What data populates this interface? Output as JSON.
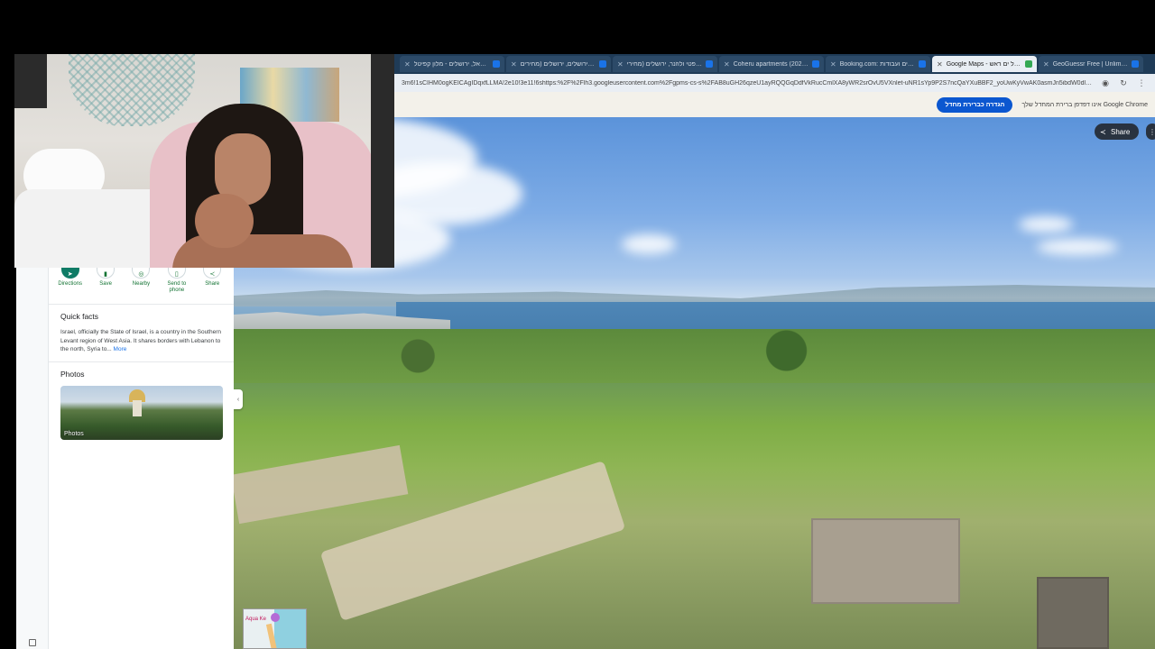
{
  "browser": {
    "tabs": [
      {
        "title": "ישראל, ירושלים - מלון קפיטל",
        "active": false
      },
      {
        "title": "מלון ירושלים, ירושלים (מחירים",
        "active": false
      },
      {
        "title": "מלון פטי ולוזנר, ירושלים (מחירי",
        "active": false
      },
      {
        "title": "Coheru apartments (2025 ב' ל",
        "active": false
      },
      {
        "title": "Booking.com: מלונים ועבודות",
        "active": false
      },
      {
        "title": "Google Maps - ישראל ים ראש",
        "active": true
      },
      {
        "title": "GeoGuessr Free | Unlimited Ma",
        "active": false
      }
    ],
    "url": "3m6!1sCIHM0ogKEICAgIDqxfLLMA!2e10!3e11!6shttps:%2F%2Flh3.googleusercontent.com%2Fgpms-cs-s%2FAB8uGH26qzeU1ayRQQGqDdfVkRucCmlXA8yWR2srOvU5VXnlet-uNR1sYp9P2S7ncQaYXuBBF2_yoUwKyVwAK0asmJn5ibdW0dlqMBo5GH26w...",
    "infobar": {
      "message": "אינו דפדפן ברירת המחדל שלך Google Chrome",
      "default_button": "הגדרה כברירת מחדל"
    }
  },
  "maps_panel": {
    "actions": [
      {
        "label": "Directions",
        "icon": "directions-icon"
      },
      {
        "label": "Save",
        "icon": "bookmark-icon"
      },
      {
        "label": "Nearby",
        "icon": "nearby-icon"
      },
      {
        "label": "Send to phone",
        "icon": "phone-icon"
      },
      {
        "label": "Share",
        "icon": "share-icon"
      }
    ],
    "quick_facts": {
      "heading": "Quick facts",
      "text": "Israel, officially the State of Israel, is a country in the Southern Levant region of West Asia. It shares borders with Lebanon to the north, Syria to...",
      "more_link": "More"
    },
    "photos": {
      "heading": "Photos",
      "thumb_label": "Photos"
    }
  },
  "streetview": {
    "share_label": "Share",
    "minimap_label": "Aqua Ke"
  },
  "colors": {
    "tab_bar": "#1f3b57",
    "accent_blue": "#0b57d0",
    "maps_green": "#0f7b66"
  }
}
